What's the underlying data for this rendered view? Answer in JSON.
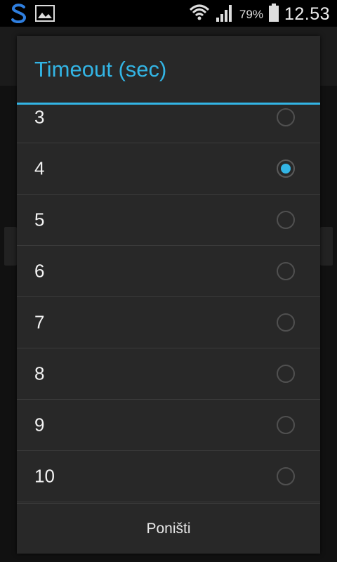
{
  "status_bar": {
    "battery_percent": "79%",
    "time": "12.53",
    "icons": [
      "app-s-icon",
      "gallery-icon",
      "wifi-icon",
      "signal-icon",
      "battery-icon"
    ]
  },
  "dialog": {
    "title": "Timeout (sec)",
    "options": [
      "3",
      "4",
      "5",
      "6",
      "7",
      "8",
      "9",
      "10"
    ],
    "selected": "4",
    "cancel_label": "Poništi"
  },
  "colors": {
    "accent": "#33b5e5",
    "dialog_bg": "#282828"
  }
}
